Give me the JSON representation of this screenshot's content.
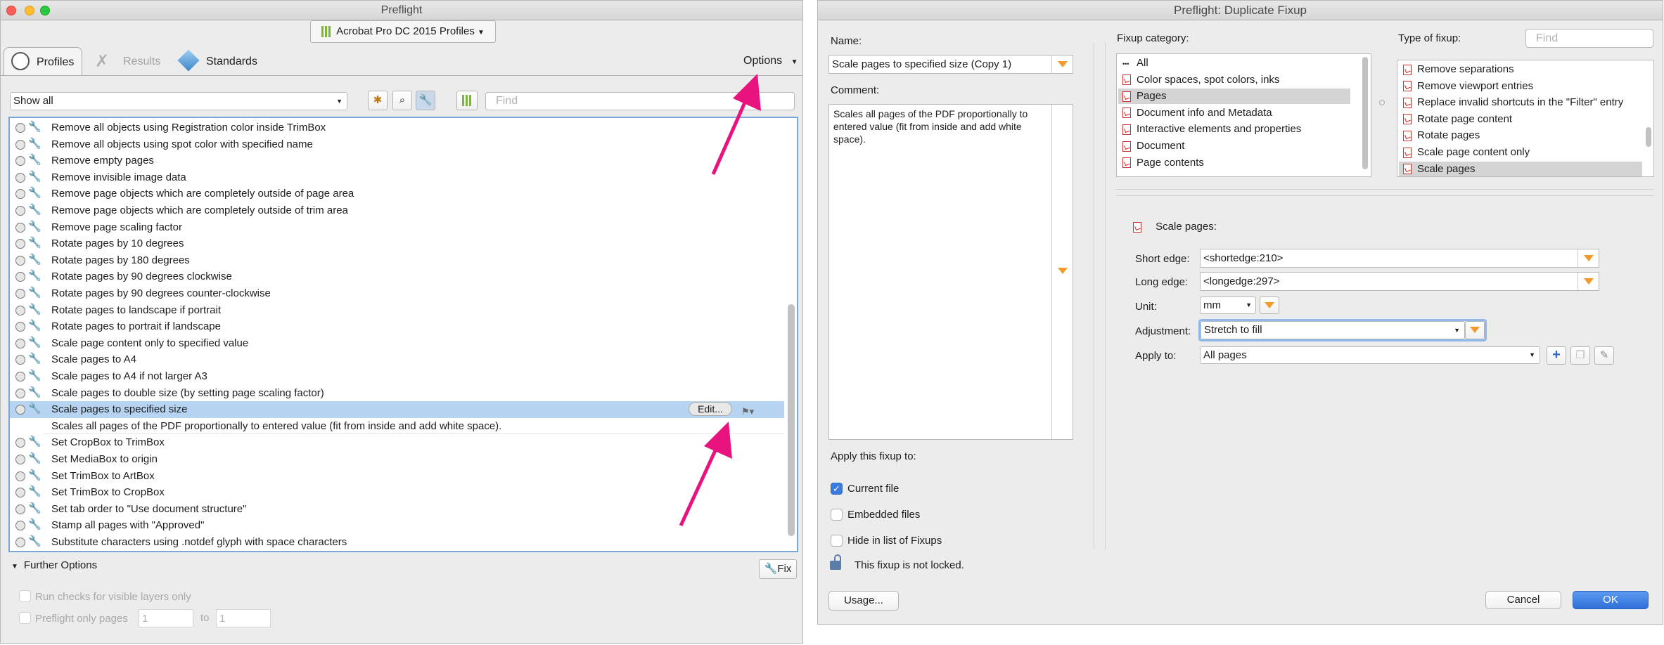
{
  "left": {
    "title": "Preflight",
    "profile_dropdown": "Acrobat Pro DC 2015 Profiles",
    "tabs": [
      "Profiles",
      "Results",
      "Standards"
    ],
    "options_label": "Options",
    "filter_select": "Show all",
    "find_placeholder": "Find",
    "list_items": [
      "Remove all objects using Registration color inside TrimBox",
      "Remove all objects using spot color with specified name",
      "Remove empty pages",
      "Remove invisible image data",
      "Remove page objects which are completely outside of page area",
      "Remove page objects which are completely outside of trim area",
      "Remove page scaling factor",
      "Rotate pages by 10 degrees",
      "Rotate pages by 180 degrees",
      "Rotate pages by 90 degrees clockwise",
      "Rotate pages by 90 degrees counter-clockwise",
      "Rotate pages to landscape if portrait",
      "Rotate pages to portrait if landscape",
      "Scale page content only to specified value",
      "Scale pages to A4",
      "Scale pages to A4 if not larger A3",
      "Scale pages to double size (by setting page scaling factor)",
      "Scale pages to specified size",
      "Scales all pages of the PDF proportionally to entered value (fit from inside and add white space).",
      "Set CropBox to TrimBox",
      "Set MediaBox to origin",
      "Set TrimBox to ArtBox",
      "Set TrimBox to CropBox",
      "Set tab order to \"Use document structure\"",
      "Stamp all pages with \"Approved\"",
      "Substitute characters using .notdef glyph with space characters"
    ],
    "edit_label": "Edit...",
    "further_options": "Further Options",
    "fix_label": "Fix",
    "run_checks": "Run checks for visible layers only",
    "preflight_only": "Preflight only pages",
    "page_from": "1",
    "to_label": "to",
    "page_to": "1"
  },
  "right": {
    "title": "Preflight: Duplicate Fixup",
    "name_label": "Name:",
    "name_value": "Scale pages to specified size (Copy 1)",
    "comment_label": "Comment:",
    "comment_value": "Scales all pages of the PDF proportionally to entered value (fit from inside and add white space).",
    "apply_this_fixup": "Apply this fixup to:",
    "current_file": "Current file",
    "embedded_files": "Embedded files",
    "hide_in_list": "Hide in list of Fixups",
    "not_locked": "This fixup is not locked.",
    "usage_btn": "Usage...",
    "fixup_category_label": "Fixup category:",
    "categories": [
      "All",
      "Color spaces, spot colors, inks",
      "Pages",
      "Document info and Metadata",
      "Interactive elements and properties",
      "Document",
      "Page contents"
    ],
    "type_label": "Type of fixup:",
    "type_find_placeholder": "Find",
    "types": [
      "Remove separations",
      "Remove viewport entries",
      "Replace invalid shortcuts in the \"Filter\" entry",
      "Rotate page content",
      "Rotate pages",
      "Scale page content only",
      "Scale pages"
    ],
    "section_title": "Scale pages:",
    "short_edge_label": "Short edge:",
    "short_edge_value": "<shortedge:210>",
    "long_edge_label": "Long edge:",
    "long_edge_value": "<longedge:297>",
    "unit_label": "Unit:",
    "unit_value": "mm",
    "adjustment_label": "Adjustment:",
    "adjustment_value": "Stretch to fill",
    "apply_to_label": "Apply to:",
    "apply_to_value": "All pages",
    "cancel_btn": "Cancel",
    "ok_btn": "OK"
  },
  "colors": {
    "accent": "#e8137e",
    "selection": "#b6d4f2",
    "ok": "#3a7be0",
    "orange": "#f39a2b"
  }
}
